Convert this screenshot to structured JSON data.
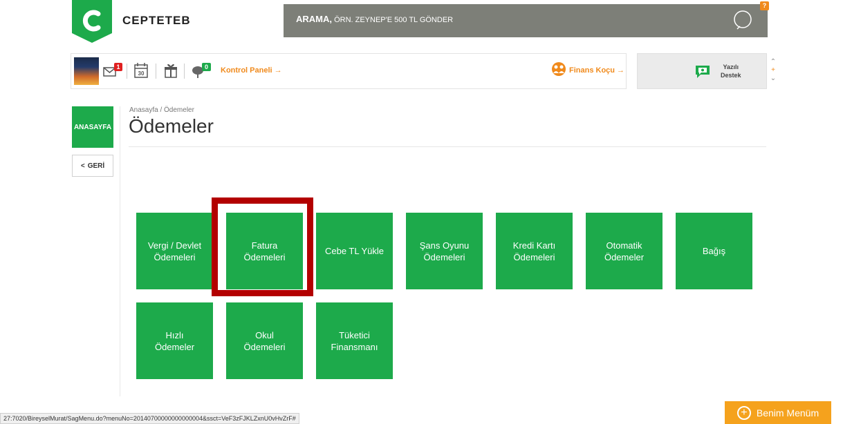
{
  "header": {
    "brand": "CEPTETEB",
    "search_label_bold": "ARAMA,",
    "search_placeholder": "ÖRN. ZEYNEP'E 500 TL GÖNDER",
    "search_badge": "?"
  },
  "dashboard": {
    "mail_badge": "1",
    "calendar_day": "30",
    "cloud_badge": "0",
    "kontrol_label": "Kontrol Paneli →",
    "finans_label": "Finans Koçu →",
    "destek_label_line1": "Yazılı",
    "destek_label_line2": "Destek"
  },
  "sidebar": {
    "home_label": "ANASAYFA",
    "back_label": "GERİ"
  },
  "page": {
    "breadcrumb": "Anasayfa / Ödemeler",
    "title": "Ödemeler"
  },
  "tiles": [
    {
      "label": "Vergi / Devlet\nÖdemeleri"
    },
    {
      "label": "Fatura\nÖdemeleri"
    },
    {
      "label": "Cebe TL Yükle"
    },
    {
      "label": "Şans Oyunu\nÖdemeleri"
    },
    {
      "label": "Kredi Kartı\nÖdemeleri"
    },
    {
      "label": "Otomatik\nÖdemeler"
    },
    {
      "label": "Bağış"
    },
    {
      "label": "Hızlı\nÖdemeler"
    },
    {
      "label": "Okul\nÖdemeleri"
    },
    {
      "label": "Tüketici\nFinansmanı"
    }
  ],
  "footer": {
    "status_url": "27:7020/BireyselMurat/SagMenu.do?menuNo=20140700000000000004&ssct=VeF3zFJKLZxnU0vHvZrF#",
    "menum_label": "Benim Menüm"
  },
  "colors": {
    "accent_green": "#1daa4b",
    "accent_orange": "#f08a1c",
    "highlight_red": "#b30000",
    "search_bg": "#7d7f78"
  }
}
